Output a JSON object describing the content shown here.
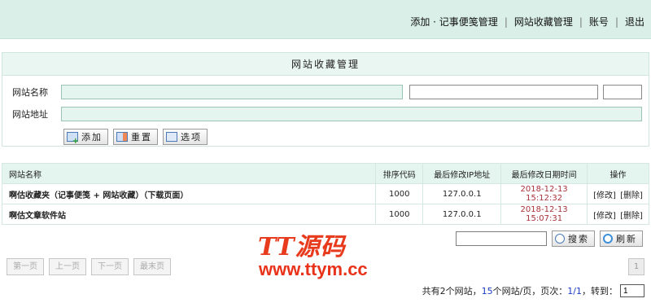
{
  "topnav": {
    "add_note": "添加 · 记事便笺管理",
    "bookmarks": "网站收藏管理",
    "account": "账号",
    "logout": "退出"
  },
  "panel": {
    "title": "网站收藏管理",
    "site_name_label": "网站名称",
    "site_url_label": "网站地址",
    "site_name_value": "",
    "site_url_value": "",
    "field2_value": "",
    "field3_value": "",
    "add_btn": "添加",
    "reset_btn": "重置",
    "options_btn": "选项"
  },
  "table": {
    "headers": [
      "网站名称",
      "排序代码",
      "最后修改IP地址",
      "最后修改日期时间",
      "操作"
    ],
    "rows": [
      {
        "name": "啊估收藏夹（记事便笺 + 网站收藏）（下载页面）",
        "order": "1000",
        "ip": "127.0.0.1",
        "date": "2018-12-13 15:12:32",
        "edit": "[修改]",
        "delete": "[删除]"
      },
      {
        "name": "啊估文章软件站",
        "order": "1000",
        "ip": "127.0.0.1",
        "date": "2018-12-13 15:07:31",
        "edit": "[修改]",
        "delete": "[删除]"
      }
    ]
  },
  "search": {
    "search_btn": "搜索",
    "refresh_btn": "刷新",
    "query": ""
  },
  "pager": {
    "first": "第一页",
    "prev": "上一页",
    "next": "下一页",
    "last": "最末页",
    "current_box": "1",
    "info_prefix": "共有2个网站，",
    "per_page": "15",
    "info_mid": "个网站/页，页次：",
    "page_of": "1/1",
    "info_jump": "，转到：",
    "jump_value": "1"
  },
  "watermark": {
    "line1": "TT源码",
    "line2": "www.ttym.cc"
  },
  "colors": {
    "topbar": "#d9efe8",
    "header_bg": "#e4f4ee",
    "date_red": "#a8323a",
    "watermark": "#e83a1c"
  }
}
